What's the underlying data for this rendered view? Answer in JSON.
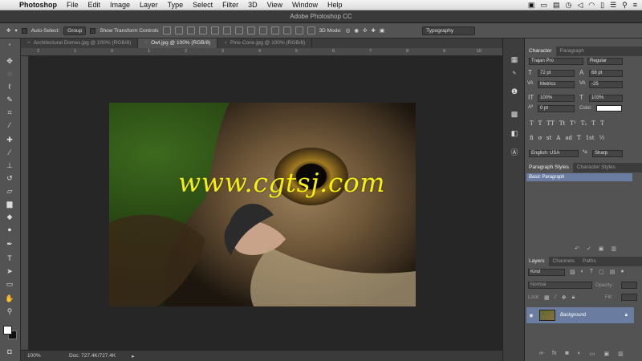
{
  "menubar": {
    "app": "Photoshop",
    "items": [
      "File",
      "Edit",
      "Image",
      "Layer",
      "Type",
      "Select",
      "Filter",
      "3D",
      "View",
      "Window",
      "Help"
    ]
  },
  "window": {
    "title": "Adobe Photoshop CC"
  },
  "options": {
    "auto_select_label": "Auto-Select:",
    "auto_select_value": "Group",
    "transform_label": "Show Transform Controls",
    "mode_3d": "3D Mode:",
    "workspace": "Typography"
  },
  "tabs": [
    {
      "label": "Architectural Domes.jpg @ 100% (RGB/8)"
    },
    {
      "label": "Owl.jpg @ 100% (RGB/8)"
    },
    {
      "label": "Pine Cone.jpg @ 100% (RGB/8)"
    }
  ],
  "ruler": {
    "marks": [
      "2",
      "1",
      "0",
      "1",
      "2",
      "3",
      "4",
      "5",
      "6",
      "7",
      "8",
      "9",
      "10"
    ]
  },
  "status": {
    "zoom": "100%",
    "doc": "Doc: 727.4K/727.4K"
  },
  "watermark": "www.cgtsj.com",
  "character_panel": {
    "tab_character": "Character",
    "tab_paragraph": "Paragraph",
    "font_family": "Trajan Pro",
    "font_style": "Regular",
    "size": "72 pt",
    "leading": "68 pt",
    "kerning": "Metrics",
    "tracking": "-25",
    "vscale": "100%",
    "hscale": "103%",
    "baseline": "0 pt",
    "color_label": "Color:",
    "language": "English: USA",
    "antialias": "Sharp",
    "glyphs": [
      "T",
      "T",
      "TT",
      "Tt",
      "T¹",
      "T₁",
      "T",
      "T"
    ],
    "ligs": [
      "fi",
      "ơ",
      "st",
      "A",
      "ad",
      "T",
      "1st",
      "½"
    ]
  },
  "styles_panel": {
    "tab_paragraph": "Paragraph Styles",
    "tab_character": "Character Styles",
    "selected": "Basic Paragraph"
  },
  "layers_panel": {
    "tab_layers": "Layers",
    "tab_channels": "Channels",
    "tab_paths": "Paths",
    "kind": "Kind",
    "blend": "Normal",
    "opacity_label": "Opacity:",
    "lock_label": "Lock:",
    "fill_label": "Fill:",
    "layer_name": "Background"
  }
}
